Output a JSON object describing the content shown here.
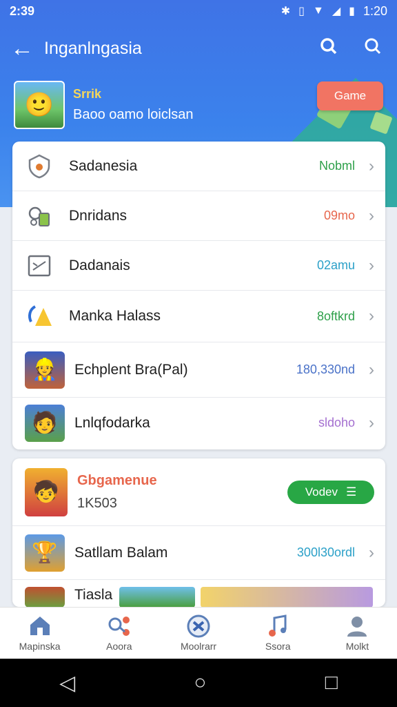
{
  "status_bar": {
    "time": "2:39",
    "clock": "1:20",
    "icons": [
      "bluetooth-icon",
      "vibrate-icon",
      "wifi-icon",
      "signal-icon",
      "battery-icon"
    ]
  },
  "appbar": {
    "title": "Inganlngasia",
    "icons": [
      "back-arrow-icon",
      "search-icon",
      "search-icon"
    ]
  },
  "profile": {
    "name": "Srrik",
    "subtitle": "Baoo oamo loiclsan",
    "button_label": "Game"
  },
  "list1": [
    {
      "label": "Sadanesia",
      "value": "Nobml",
      "value_color": "#2ea04a",
      "icon": "shield-icon"
    },
    {
      "label": "Dnridans",
      "value": "09mo",
      "value_color": "#e7664c",
      "icon": "devices-icon"
    },
    {
      "label": "Dadanais",
      "value": "02amu",
      "value_color": "#2ba0c8",
      "icon": "image-icon"
    },
    {
      "label": "Manka Halass",
      "value": "8oftkrd",
      "value_color": "#2ea04a",
      "icon": "warning-icon"
    },
    {
      "label": "Echplent Bra(Pal)",
      "value": "180,330nd",
      "value_color": "#4a72c8",
      "icon": "game-avatar-icon"
    },
    {
      "label": "Lnlqfodarka",
      "value": "sldoho",
      "value_color": "#a46fd0",
      "icon": "game-avatar-icon"
    }
  ],
  "list2": {
    "featured": {
      "title": "Gbgamenue",
      "subtitle": "1K503",
      "button_label": "Vodev"
    },
    "rows": [
      {
        "label": "Satllam Balam",
        "value": "300l30ordl",
        "value_color": "#2ba0c8"
      },
      {
        "label": "Tiasla",
        "value": "",
        "value_color": "#2ba0c8"
      }
    ]
  },
  "bottom_nav": [
    {
      "label": "Mapinska",
      "icon": "home-icon"
    },
    {
      "label": "Aoora",
      "icon": "share-icon"
    },
    {
      "label": "Moolrarr",
      "icon": "games-icon"
    },
    {
      "label": "Ssora",
      "icon": "music-icon"
    },
    {
      "label": "Molkt",
      "icon": "profile-icon"
    }
  ],
  "system_nav": [
    "back-icon",
    "home-icon",
    "recents-icon"
  ]
}
